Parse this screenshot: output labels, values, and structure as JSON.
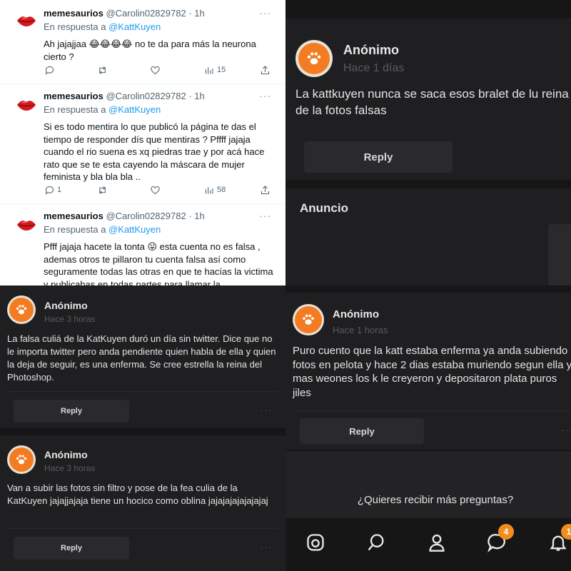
{
  "twitter": {
    "tweets": [
      {
        "name": "memesaurios",
        "handle": "@Carolin02829782",
        "time": "· 1h",
        "reply_prefix": "En respuesta a",
        "reply_to": "@KattKuyen",
        "text": "Ah jajajjaa 😂😂😂😂 no te da para más la neurona cierto ?",
        "replies": "",
        "views": "15"
      },
      {
        "name": "memesaurios",
        "handle": "@Carolin02829782",
        "time": "· 1h",
        "reply_prefix": "En respuesta a",
        "reply_to": "@KattKuyen",
        "text": "Si es todo mentira lo que publicó la página te das el tiempo de responder dís que mentiras ? Pffff jajaja cuando el rio suena es xq piedras trae y por acá hace rato que se te esta cayendo la máscara de mujer feminista y bla bla bla ..",
        "replies": "1",
        "views": "58"
      },
      {
        "name": "memesaurios",
        "handle": "@Carolin02829782",
        "time": "· 1h",
        "reply_prefix": "En respuesta a",
        "reply_to": "@KattKuyen",
        "text": "Pfff jajaja hacete la tonta 😛 esta cuenta no es falsa , ademas otros te pillaron tu cuenta falsa así como seguramente todas las otras en que te hacías la victima y publicabas en todas partes para llamar la",
        "replies": "",
        "views": ""
      }
    ]
  },
  "top_right": {
    "name": "Anónimo",
    "time": "Hace 1 días",
    "text": "La kattkuyen nunca se saca esos bralet de lu reina de la fotos falsas",
    "reply_label": "Reply",
    "ad_label": "Anuncio"
  },
  "bottom_left": {
    "posts": [
      {
        "name": "Anónimo",
        "time": "Hace 3 horas",
        "text": "La falsa culiá de la KatKuyen duró un día sin twitter. Dice que no le importa twitter pero anda pendiente quien habla de ella y quien la deja de seguir, es una enferma. Se cree estrella la reina del Photoshop.",
        "reply_label": "Reply"
      },
      {
        "name": "Anónimo",
        "time": "Hace 3 horas",
        "text": "Van a subir las fotos sin filtro y pose de la fea culia de la KatKuyen jajajjajaja tiene un hocico como oblina jajajajajajajajaj",
        "reply_label": "Reply"
      }
    ]
  },
  "bottom_right": {
    "name": "Anónimo",
    "time": "Hace 1 horas",
    "text": "Puro cuento que la katt estaba enferma ya anda subiendo fotos en pelota y hace 2 dias estaba muriendo segun ella y mas weones los k le creyeron y depositaron plata puros jiles",
    "reply_label": "Reply",
    "prompt": "¿Quieres recibir más preguntas?",
    "nav": {
      "messages_badge": "4",
      "notifications_badge": "1"
    }
  },
  "colors": {
    "twitter_link": "#1d9bf0",
    "brand_orange": "#f37c22",
    "dark_bg": "#161617"
  }
}
